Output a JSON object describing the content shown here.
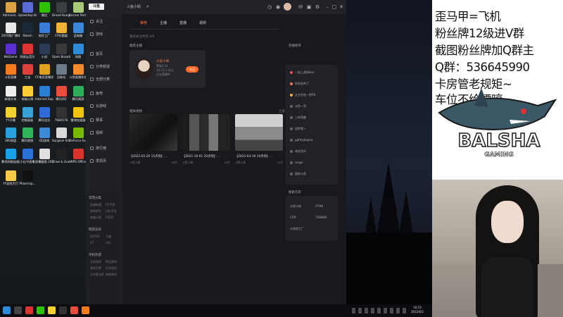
{
  "desktop_icons": [
    {
      "label": "Administ...",
      "color": "#d9a441"
    },
    {
      "label": "Splashtop Business",
      "color": "#5b6bd6"
    },
    {
      "label": "微信",
      "color": "#2dc100"
    },
    {
      "label": "Dread Hunger",
      "color": "#3a3f44"
    },
    {
      "label": "Farmer Party",
      "color": "#a7c97a"
    },
    {
      "label": "2019版广播电视编导...",
      "color": "#e8e8e8"
    },
    {
      "label": "Steam",
      "color": "#1b2838"
    },
    {
      "label": "他优工厂",
      "color": "#3b7bd8"
    },
    {
      "label": "CF时题器",
      "color": "#f2b233"
    },
    {
      "label": "此电脑",
      "color": "#3b86d6"
    },
    {
      "label": "WeGame",
      "color": "#5c2fd1"
    },
    {
      "label": "网易云音乐",
      "color": "#d33"
    },
    {
      "label": "小说",
      "color": "#2b3a55"
    },
    {
      "label": "Open Broadcast...",
      "color": "#3a3a3a"
    },
    {
      "label": "网络",
      "color": "#2f8ad8"
    },
    {
      "label": "斗鱼直播",
      "color": "#f57c1f"
    },
    {
      "label": "三宝",
      "color": "#d8423a"
    },
    {
      "label": "CF电竞直播伴侣",
      "color": "#e0a020"
    },
    {
      "label": "回收站",
      "color": "#6c7a8a"
    },
    {
      "label": "斗鱼直播伴侣",
      "color": "#f48a2b"
    },
    {
      "label": "新建文本",
      "color": "#eeeeee"
    },
    {
      "label": "穿越火线",
      "color": "#ffcc33"
    },
    {
      "label": "Internet Explorer",
      "color": "#2a7fd4"
    },
    {
      "label": "腾讯QQ",
      "color": "#e74c3c"
    },
    {
      "label": "腾讯视频",
      "color": "#2cae5a"
    },
    {
      "label": "YY开播",
      "color": "#f2d231"
    },
    {
      "label": "控制面板",
      "color": "#3aa0d8"
    },
    {
      "label": "腾讯会议",
      "color": "#2f6ad8"
    },
    {
      "label": "768X576",
      "color": "#333"
    },
    {
      "label": "雷神加速器",
      "color": "#f1c40f"
    },
    {
      "label": "360网盘",
      "color": "#28a3e0"
    },
    {
      "label": "腾讯视频",
      "color": "#2fb65d"
    },
    {
      "label": "QQ游戏",
      "color": "#3d8bd8"
    },
    {
      "label": "Surgeon Simulator 2",
      "color": "#d9d9d9"
    },
    {
      "label": "GeForce Experience",
      "color": "#76b900"
    },
    {
      "label": "腾讯网络加速器",
      "color": "#1aa0e8"
    },
    {
      "label": "小红书直播",
      "color": "#2b6fd8"
    },
    {
      "label": "屏幕截图 2022...",
      "color": "#e0e0e0"
    },
    {
      "label": "Draw & Guess",
      "color": "#222"
    },
    {
      "label": "WPS Office",
      "color": "#d9342b"
    },
    {
      "label": "YY游戏大厅",
      "color": "#f7c948"
    },
    {
      "label": "Phasmop...",
      "color": "#111"
    }
  ],
  "app": {
    "logo": "斗鱼",
    "tab_name": "斗鱼小助",
    "search_icon": "search-icon",
    "sidebar": [
      {
        "label": "关注"
      },
      {
        "label": "游戏"
      },
      {
        "label": "首页"
      },
      {
        "label": "分类频道"
      },
      {
        "label": "全部分类"
      },
      {
        "label": "鱼吧"
      },
      {
        "label": "云游戏"
      },
      {
        "label": "赛事"
      },
      {
        "label": "视频"
      },
      {
        "label": "排行榜"
      },
      {
        "label": "发现页"
      }
    ],
    "sub_sections": [
      {
        "title": "常用分类",
        "cells": [
          "英雄联盟",
          "CF手游",
          "绝地求生",
          "LOL手游",
          "穿越火线",
          "CSGO"
        ]
      },
      {
        "title": "网游竞技",
        "cells": [
          "DOTA2",
          "王者",
          "CF",
          "LOL"
        ]
      },
      {
        "title": "单机热游",
        "cells": [
          "主机游戏",
          "怀旧游戏",
          "我的世界",
          "生化危机",
          "艾尔登法环",
          "其他单机"
        ]
      }
    ],
    "sidebar_bottom": [
      "开播",
      "客服"
    ],
    "tabs": [
      {
        "label": "推荐",
        "active": true
      },
      {
        "label": "主播"
      },
      {
        "label": "直播"
      },
      {
        "label": "视频"
      }
    ],
    "greeting": "我的关注共有 0/5",
    "featured_title": "推荐主播",
    "featured": {
      "name": "斗鱼小球",
      "line1": "等级3 LV",
      "line2": "14.5万人关注",
      "line3": "正在直播中",
      "follow_label": "关注"
    },
    "videos_title": "相关视频",
    "videos_more": "全部",
    "videos": [
      {
        "title": "【2022-05-26 15点场】...",
        "author": "斗鱼小球",
        "count": "56次"
      },
      {
        "title": "【2021-10-01 20点场】...",
        "author": "斗鱼小球",
        "count": "28次"
      },
      {
        "title": "【2022-03-19 19点场】...",
        "author": "斗鱼小球",
        "count": "25次"
      }
    ],
    "hot_title": "热搜榜单",
    "hot_items": [
      {
        "label": "一起上战场kiss",
        "color": "#ff4d4f"
      },
      {
        "label": "阿业吃鸡了",
        "color": "#ff7a45"
      },
      {
        "label": "五五在吃一把FN",
        "color": "#ffa940"
      },
      {
        "label": "斗鱼一哥",
        "color": "#666"
      },
      {
        "label": "三体答题",
        "color": "#666"
      },
      {
        "label": "追梦第一",
        "color": "#666"
      },
      {
        "label": "pgfmyeigsee",
        "color": "#666"
      },
      {
        "label": "湖北东风",
        "color": "#666"
      },
      {
        "label": "rouge",
        "color": "#666"
      },
      {
        "label": "超新斗鱼",
        "color": "#666"
      }
    ],
    "history_title": "搜索历史",
    "history": [
      "斗鱼小球",
      "CFHD",
      "CFM",
      "75BNSB",
      "斗鱼他工厂"
    ]
  },
  "overlay_lines": [
    "歪马甲=飞机",
    "粉丝牌12级进V群",
    "截图粉丝牌加Q群主",
    "Q群：536645990",
    "卡房管老规矩~",
    "车位不给嫖哼"
  ],
  "logo_text": "BALSHA",
  "logo_sub": "GAMING",
  "tray": {
    "time": "16:23",
    "date": "2022/6/2"
  }
}
